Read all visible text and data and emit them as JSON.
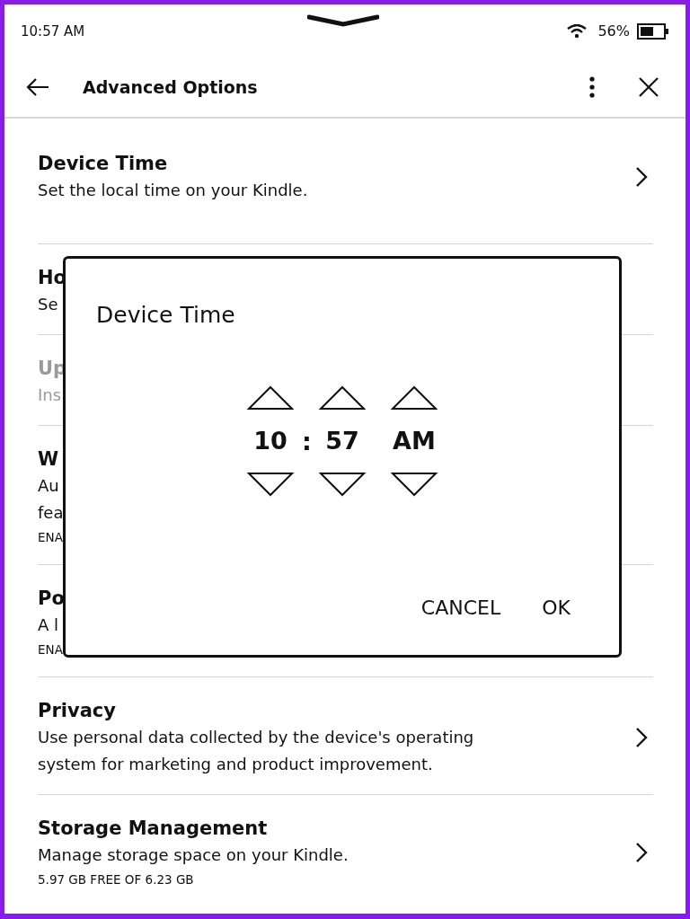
{
  "status_bar": {
    "time": "10:57 AM",
    "battery": "56%"
  },
  "header": {
    "title": "Advanced Options"
  },
  "items": [
    {
      "title": "Device Time",
      "lines": [
        "Set the local time on your Kindle."
      ],
      "kind": "link",
      "disabled": false
    },
    {
      "title": "Ho",
      "lines": [
        "Se"
      ],
      "kind": "plain",
      "disabled": false
    },
    {
      "title": "Up",
      "lines": [
        "Ins"
      ],
      "kind": "plain",
      "disabled": true
    },
    {
      "title": "W",
      "lines": [
        "Au",
        "fea"
      ],
      "note": "ENA",
      "kind": "plain",
      "disabled": false
    },
    {
      "title": "Po",
      "lines": [
        "A l"
      ],
      "note": "ENA",
      "kind": "plain",
      "disabled": false
    },
    {
      "title": "Privacy",
      "lines": [
        "Use personal data collected by the device's operating",
        "system for marketing and product improvement."
      ],
      "kind": "link",
      "disabled": false
    },
    {
      "title": "Storage Management",
      "lines": [
        "Manage storage space on your Kindle."
      ],
      "note": "5.97 GB FREE OF 6.23 GB",
      "kind": "link",
      "disabled": false
    }
  ],
  "dialog": {
    "title": "Device Time",
    "fields": [
      {
        "value": "10"
      },
      {
        "value": "57"
      },
      {
        "value": "AM"
      }
    ],
    "separator": ":",
    "buttons": [
      "CANCEL",
      "OK"
    ]
  }
}
